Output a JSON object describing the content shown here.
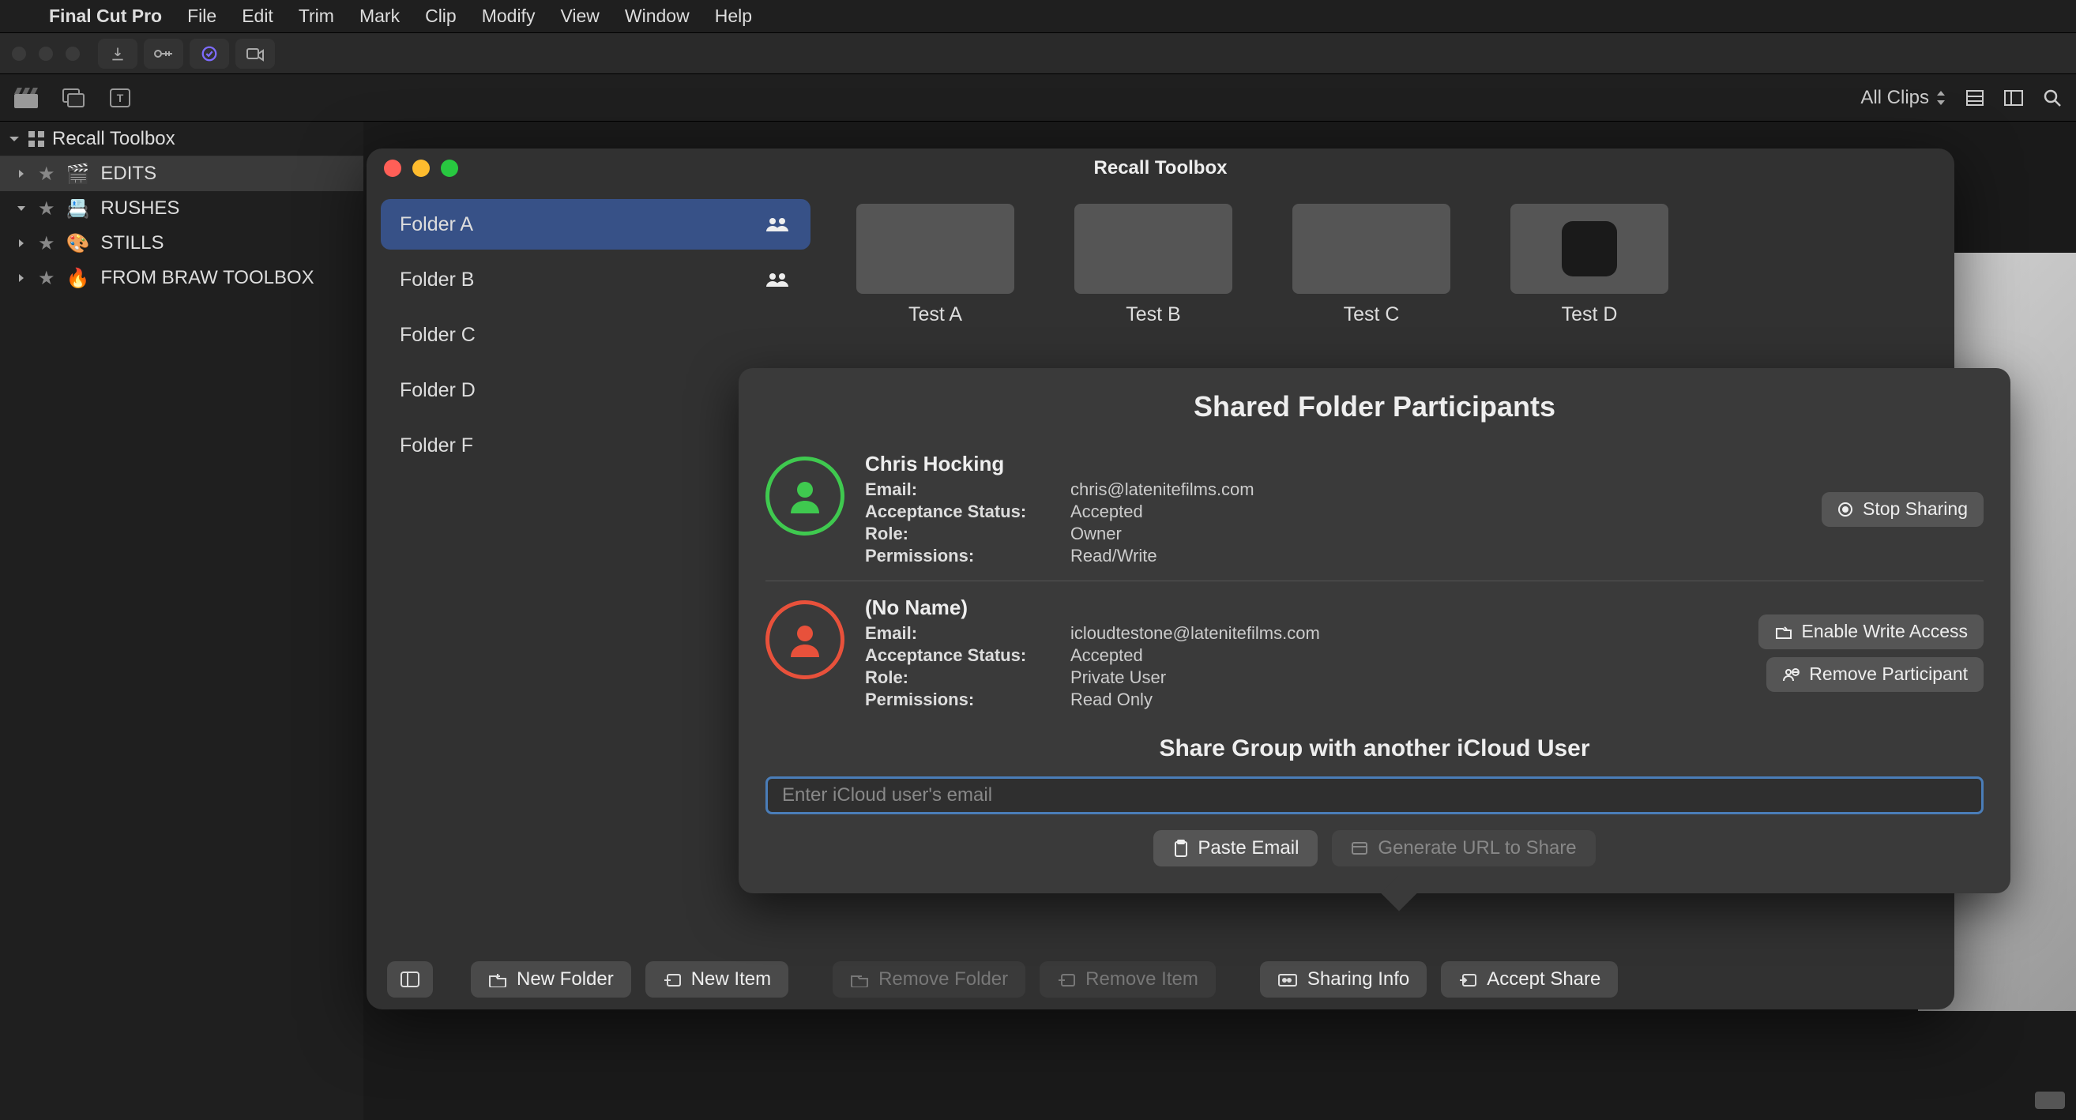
{
  "menubar": {
    "app": "Final Cut Pro",
    "items": [
      "File",
      "Edit",
      "Trim",
      "Mark",
      "Clip",
      "Modify",
      "View",
      "Window",
      "Help"
    ]
  },
  "sec_toolbar": {
    "clips_label": "All Clips"
  },
  "browser": {
    "title": "Recall Toolbox",
    "items": [
      {
        "emoji": "🎬",
        "label": "EDITS",
        "expanded": false,
        "selected": true,
        "dir": "right"
      },
      {
        "emoji": "📇",
        "label": "RUSHES",
        "expanded": true,
        "selected": false,
        "dir": "down"
      },
      {
        "emoji": "🎨",
        "label": "STILLS",
        "expanded": false,
        "selected": false,
        "dir": "right"
      },
      {
        "emoji": "🔥",
        "label": "FROM BRAW TOOLBOX",
        "expanded": false,
        "selected": false,
        "dir": "right"
      }
    ]
  },
  "window": {
    "title": "Recall Toolbox",
    "folders": [
      {
        "label": "Folder A",
        "shared": true,
        "active": true
      },
      {
        "label": "Folder B",
        "shared": true,
        "active": false
      },
      {
        "label": "Folder C",
        "shared": false,
        "active": false
      },
      {
        "label": "Folder D",
        "shared": false,
        "active": false
      },
      {
        "label": "Folder F",
        "shared": false,
        "active": false
      }
    ],
    "thumbs": [
      {
        "label": "Test A"
      },
      {
        "label": "Test B"
      },
      {
        "label": "Test C"
      },
      {
        "label": "Test D"
      }
    ],
    "bottom": {
      "new_folder": "New Folder",
      "new_item": "New Item",
      "remove_folder": "Remove Folder",
      "remove_item": "Remove Item",
      "sharing_info": "Sharing Info",
      "accept_share": "Accept Share"
    }
  },
  "popover": {
    "title": "Shared Folder Participants",
    "participants": [
      {
        "name": "Chris Hocking",
        "email_label": "Email:",
        "email": "chris@latenitefilms.com",
        "status_label": "Acceptance Status:",
        "status": "Accepted",
        "role_label": "Role:",
        "role": "Owner",
        "perm_label": "Permissions:",
        "perm": "Read/Write",
        "color": "green",
        "actions": [
          {
            "label": "Stop Sharing",
            "icon": "stop"
          }
        ]
      },
      {
        "name": "(No Name)",
        "email_label": "Email:",
        "email": "icloudtestone@latenitefilms.com",
        "status_label": "Acceptance Status:",
        "status": "Accepted",
        "role_label": "Role:",
        "role": "Private User",
        "perm_label": "Permissions:",
        "perm": "Read Only",
        "color": "red",
        "actions": [
          {
            "label": "Enable Write Access",
            "icon": "write"
          },
          {
            "label": "Remove Participant",
            "icon": "remove"
          }
        ]
      }
    ],
    "share_heading": "Share Group with another iCloud User",
    "email_placeholder": "Enter iCloud user's email",
    "paste_email": "Paste Email",
    "gen_url": "Generate URL to Share"
  }
}
